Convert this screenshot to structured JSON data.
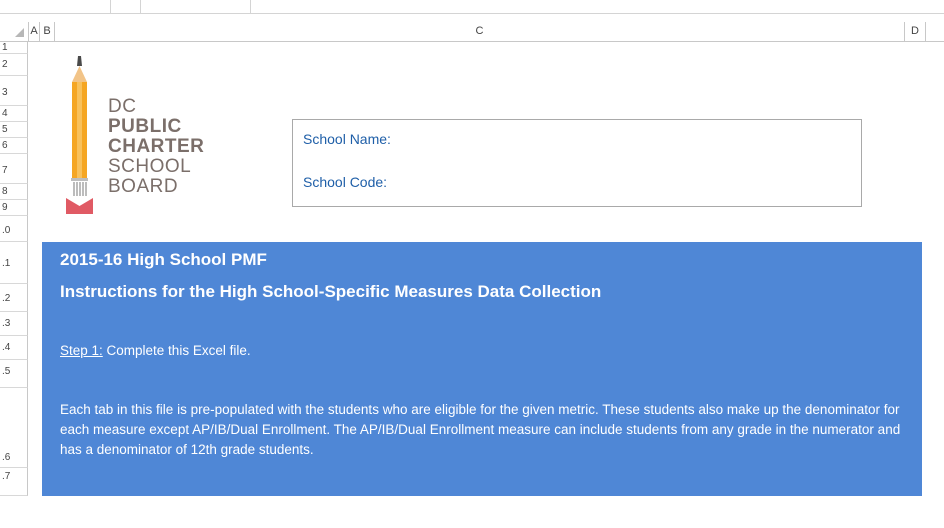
{
  "columns": [
    "A",
    "B",
    "C",
    "D"
  ],
  "rows": [
    "1",
    "2",
    "3",
    "4",
    "5",
    "6",
    "7",
    "8",
    "9",
    ".0",
    ".1",
    ".2",
    ".3",
    ".4",
    ".5",
    ".6",
    ".7"
  ],
  "logo": {
    "line1": "DC",
    "line2": "PUBLIC",
    "line3": "CHARTER",
    "line4": "SCHOOL",
    "line5": "BOARD",
    "icon": "pencil-logo-icon",
    "colors": {
      "pencil": "#f5a623",
      "eraser": "#e05a64",
      "text": "#7b6f6a"
    }
  },
  "info_box": {
    "school_name_label": "School Name:",
    "school_code_label": "School Code:"
  },
  "instructions": {
    "title": "2015-16 High School PMF",
    "subtitle": "Instructions for the High School-Specific Measures Data Collection",
    "step1_label": "Step 1:",
    "step1_text": " Complete this Excel file.",
    "paragraph": "Each tab in this file is pre-populated with the students who are eligible for the given metric. These students also make up the denominator for each measure except AP/IB/Dual Enrollment. The AP/IB/Dual Enrollment measure can include students from any grade in the numerator and has a denominator of 12th grade students.",
    "background_color": "#4f87d6"
  }
}
